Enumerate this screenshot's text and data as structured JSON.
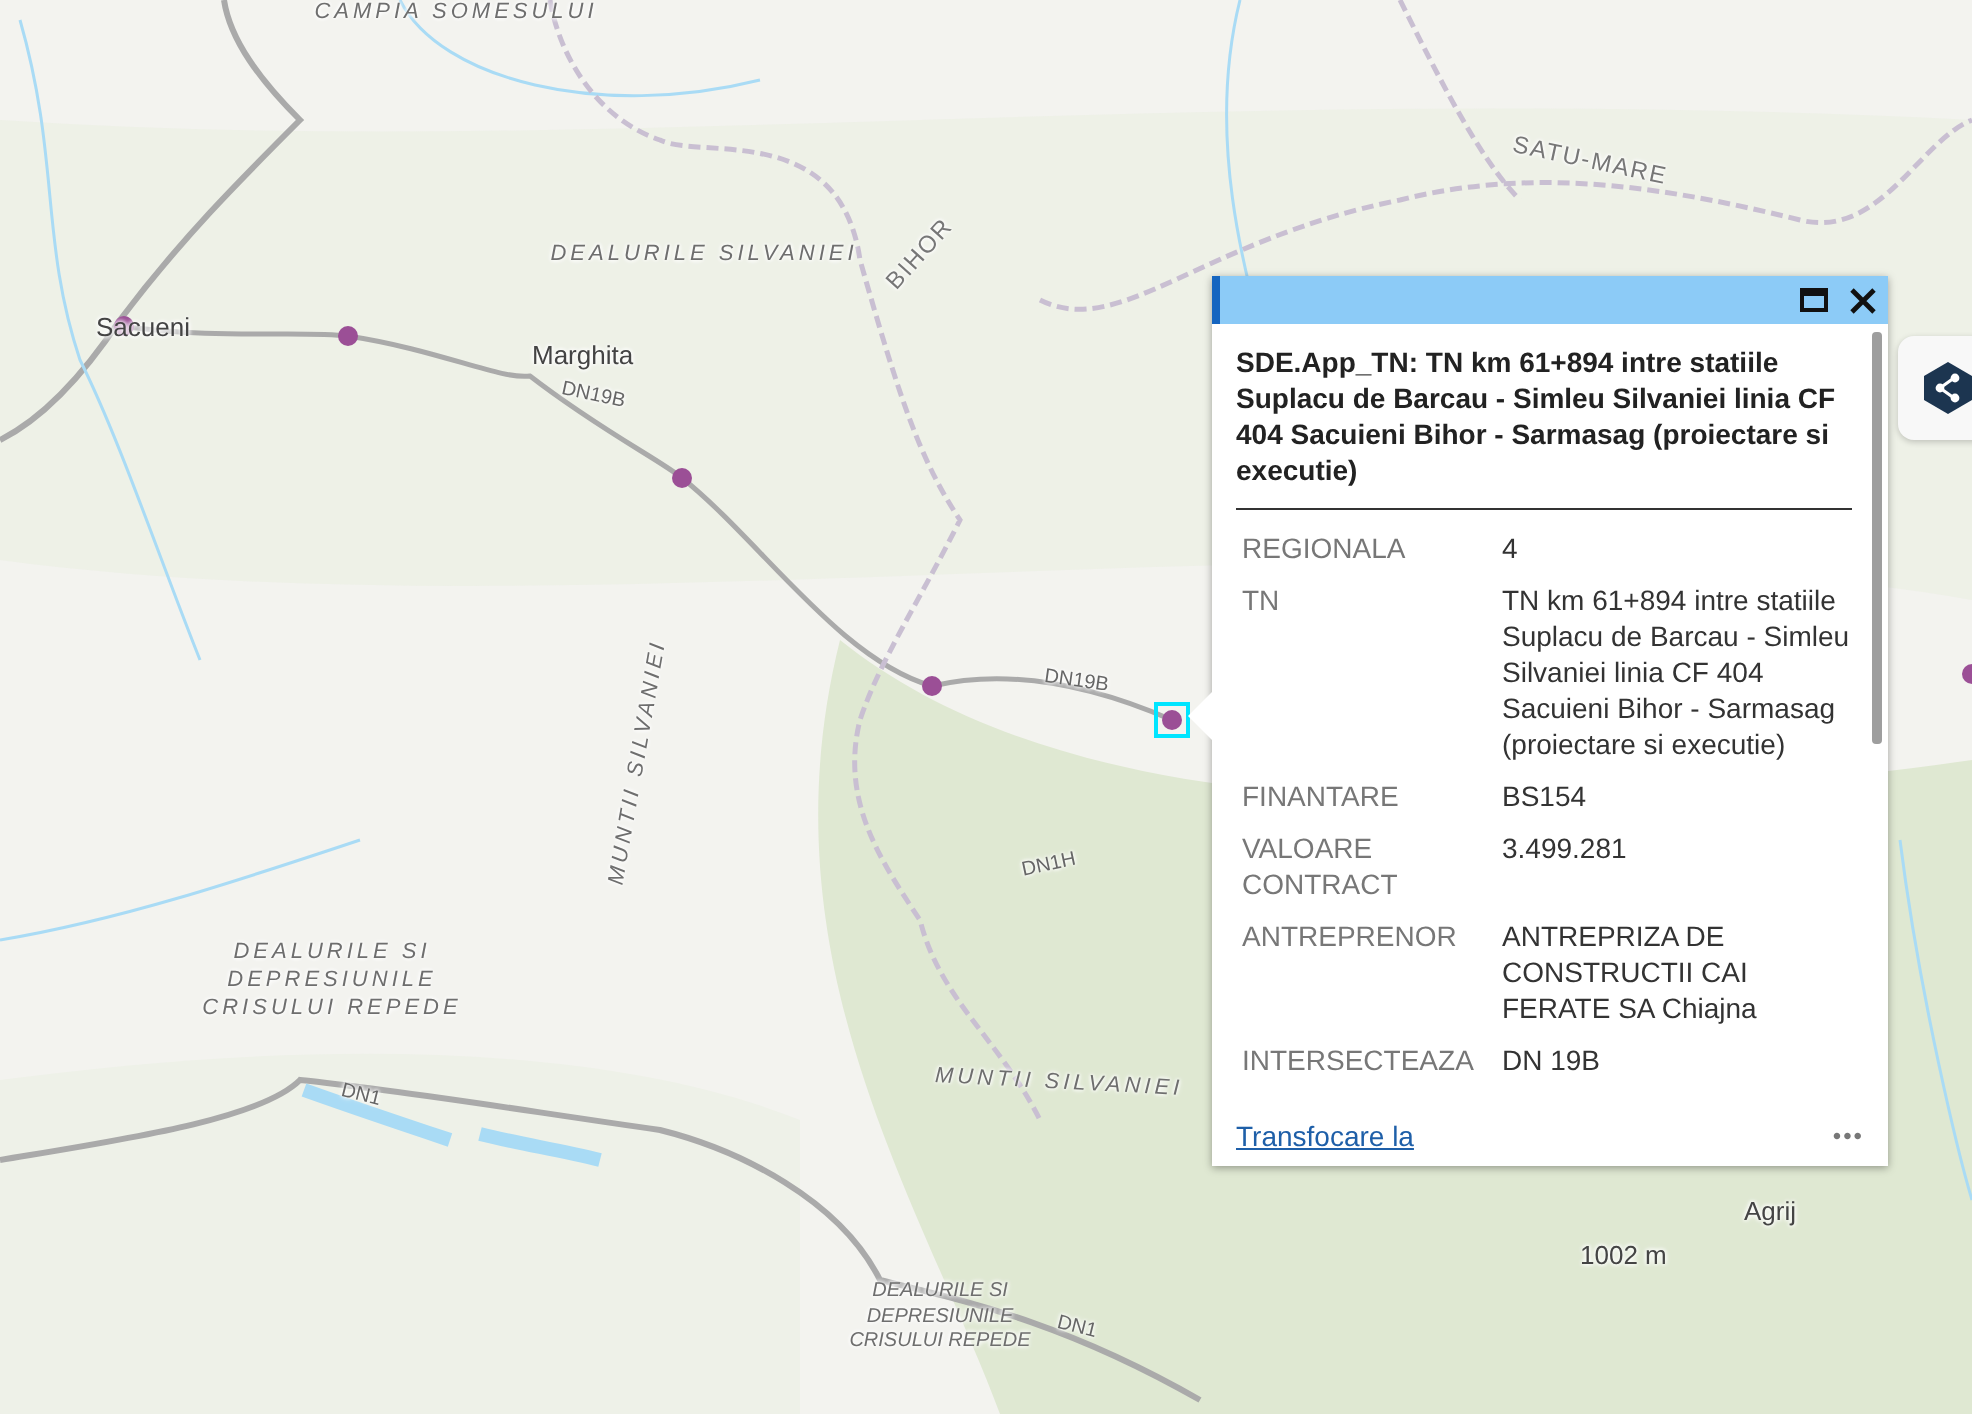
{
  "map": {
    "labels": [
      {
        "text": "CAMPIA SOMESULUI",
        "kind": "region"
      },
      {
        "text": "Sacueni",
        "kind": "town"
      },
      {
        "text": "DEALURILE SILVANIEI",
        "kind": "region"
      },
      {
        "text": "Marghita",
        "kind": "town"
      },
      {
        "text": "BIHOR",
        "kind": "county"
      },
      {
        "text": "SATU-MARE",
        "kind": "county"
      },
      {
        "text": "DN19B",
        "kind": "road"
      },
      {
        "text": "DN19B",
        "kind": "road"
      },
      {
        "text": "DN1H",
        "kind": "road"
      },
      {
        "text": "MUNTII SILVANIEI",
        "kind": "region"
      },
      {
        "text": "MUNTII SILVANIEI",
        "kind": "region"
      },
      {
        "text": "DEALURILE SI DEPRESIUNILE CRISULUI REPEDE",
        "kind": "region"
      },
      {
        "text": "DN1",
        "kind": "road"
      },
      {
        "text": "DEALURILE SI DEPRESIUNILE CRISULUI REPEDE",
        "kind": "region"
      },
      {
        "text": "DN1",
        "kind": "road"
      },
      {
        "text": "Agrij",
        "kind": "town"
      },
      {
        "text": "1002 m",
        "kind": "town"
      }
    ]
  },
  "popup": {
    "title": "SDE.App_TN: TN km 61+894 intre statiile Suplacu de Barcau - Simleu Silvaniei linia CF 404 Sacuieni Bihor - Sarmasag (proiectare si executie)",
    "fields": [
      {
        "label": "REGIONALA",
        "value": "4"
      },
      {
        "label": "TN",
        "value": "TN km 61+894 intre statiile Suplacu de Barcau - Simleu Silvaniei linia CF 404 Sacuieni Bihor - Sarmasag (proiectare si executie)"
      },
      {
        "label": "FINANTARE",
        "value": "BS154"
      },
      {
        "label": "VALOARE CONTRACT",
        "value": "3.499.281"
      },
      {
        "label": "ANTREPRENOR",
        "value": "ANTREPRIZA DE CONSTRUCTII CAI FERATE SA Chiajna"
      },
      {
        "label": "INTERSECTEAZA",
        "value": "DN 19B"
      }
    ],
    "zoom_link": "Transfocare la",
    "more": "•••"
  }
}
